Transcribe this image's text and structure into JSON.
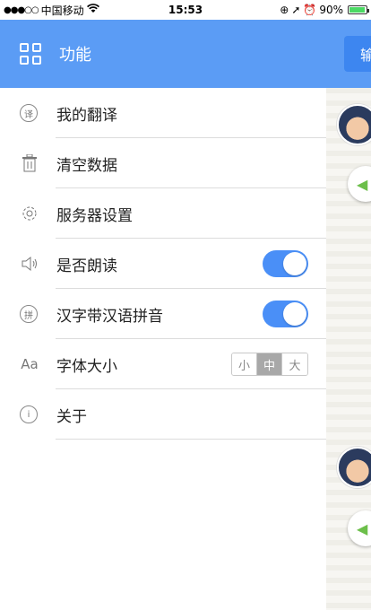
{
  "status_bar": {
    "signal": "●●●○○",
    "carrier": "中国移动",
    "wifi_icon": "wifi-icon",
    "time": "15:53",
    "battery": "90%"
  },
  "drawer": {
    "title": "功能",
    "header_color": "#5b9cf5"
  },
  "background_app": {
    "button_label": "输"
  },
  "menu": [
    {
      "label": "我的翻译",
      "icon": "translate-icon",
      "icon_text": "译"
    },
    {
      "label": "清空数据",
      "icon": "trash-icon"
    },
    {
      "label": "服务器设置",
      "icon": "gear-icon"
    },
    {
      "label": "是否朗读",
      "icon": "speaker-icon",
      "toggle": true
    },
    {
      "label": "汉字带汉语拼音",
      "icon": "pinyin-icon",
      "icon_text": "拼",
      "toggle": true
    },
    {
      "label": "字体大小",
      "icon": "font-size-icon",
      "icon_text": "Aa",
      "options": [
        "小",
        "中",
        "大"
      ],
      "selected": "中"
    },
    {
      "label": "关于",
      "icon": "info-icon",
      "icon_text": "i"
    }
  ],
  "accent_color": "#4a8ff7"
}
